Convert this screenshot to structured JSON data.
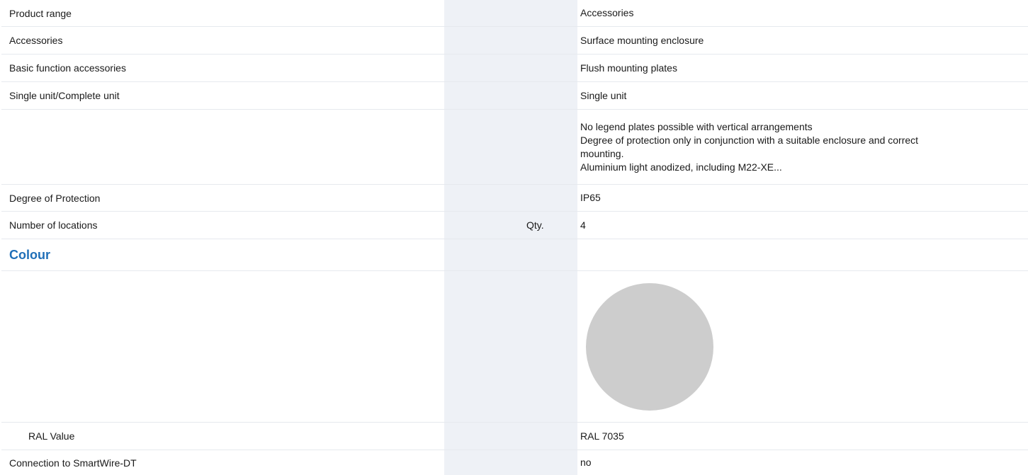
{
  "rows": [
    {
      "label": "Product range",
      "unit": "",
      "value": "Accessories"
    },
    {
      "label": "Accessories",
      "unit": "",
      "value": "Surface mounting enclosure"
    },
    {
      "label": "Basic function accessories",
      "unit": "",
      "value": "Flush mounting plates"
    },
    {
      "label": "Single unit/Complete unit",
      "unit": "",
      "value": "Single unit"
    },
    {
      "label": "",
      "unit": "",
      "value_lines": [
        "No legend plates possible with vertical arrangements",
        "Degree of protection only in conjunction with a suitable enclosure and correct",
        "mounting.",
        "Aluminium light anodized, including M22-XE..."
      ]
    },
    {
      "label": "Degree of Protection",
      "unit": "",
      "value": "IP65"
    },
    {
      "label": "Number of locations",
      "unit": "Qty.",
      "value": "4"
    }
  ],
  "colour_section": {
    "title": "Colour",
    "swatch_color": "#cdcdcd",
    "ral_label": "RAL Value",
    "ral_value": "RAL 7035"
  },
  "last_row": {
    "label": "Connection to SmartWire-DT",
    "unit": "",
    "value": "no"
  },
  "colors": {
    "accent": "#1f6fb8",
    "column_shade": "#eef1f6",
    "row_border": "#e6e9ee"
  }
}
